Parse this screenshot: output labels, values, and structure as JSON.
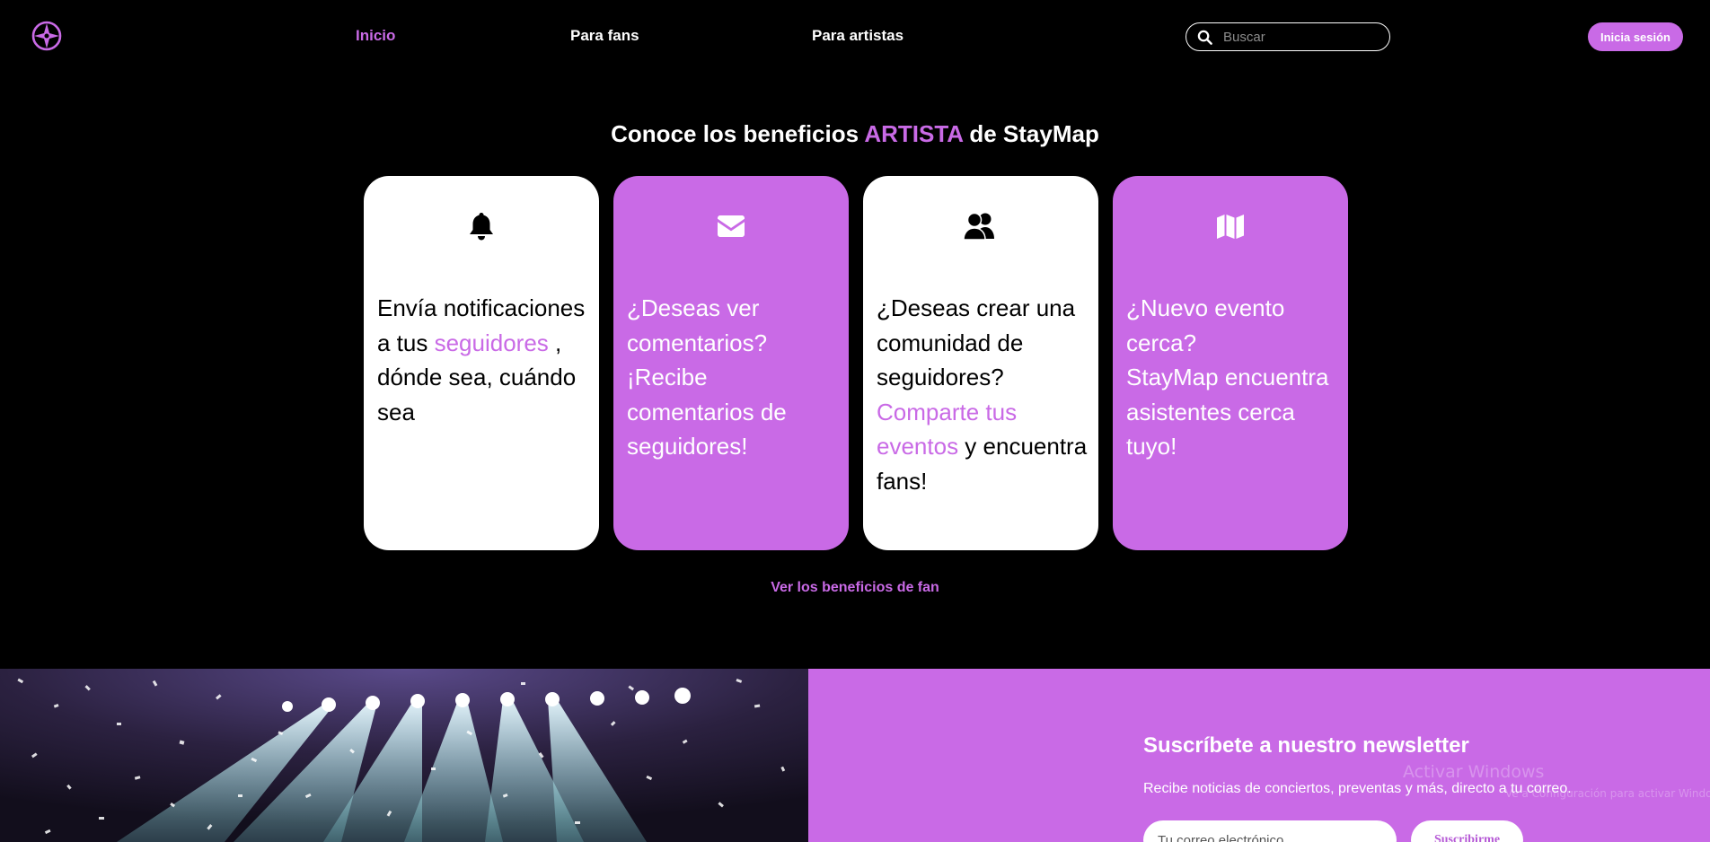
{
  "header": {
    "logo_icon": "compass-icon",
    "nav": [
      {
        "label": "Inicio",
        "active": true
      },
      {
        "label": "Para fans",
        "active": false
      },
      {
        "label": "Para artistas",
        "active": false
      }
    ],
    "search": {
      "placeholder": "Buscar",
      "value": ""
    },
    "login_label": "Inicia sesión"
  },
  "benefits": {
    "title_pre": "Conoce los beneficios ",
    "title_accent": "ARTISTA",
    "title_post": " de StayMap",
    "cards": [
      {
        "icon": "bell-icon",
        "style": "white",
        "text_1": "Envía notificaciones a tus ",
        "highlight": "seguidores",
        "text_2": " , dónde sea, cuándo sea"
      },
      {
        "icon": "envelope-icon",
        "style": "purple",
        "line_1": "¿Deseas ver comentarios?",
        "line_2": "¡Recibe comentarios de seguidores!"
      },
      {
        "icon": "users-icon",
        "style": "white",
        "text_1": "¿Deseas crear una comunidad de seguidores? ",
        "highlight": "Comparte tus eventos",
        "text_2": " y encuentra fans!"
      },
      {
        "icon": "map-icon",
        "style": "purple",
        "line_1": "¿Nuevo evento cerca?",
        "line_2": "StayMap encuentra asistentes cerca tuyo!"
      }
    ],
    "fan_link": "Ver los beneficios de fan"
  },
  "newsletter": {
    "title": "Suscríbete a nuestro newsletter",
    "subtitle": "Recibe noticias de conciertos, preventas y más, directo a tu correo.",
    "email_placeholder": "Tu correo electrónico",
    "button_label": "Suscribirme",
    "watermark": "Activar Windows",
    "watermark_sub": "Ve a Configuración para activar Windows."
  },
  "colors": {
    "accent": "#c96ae6",
    "background": "#000000",
    "card_white": "#ffffff"
  }
}
